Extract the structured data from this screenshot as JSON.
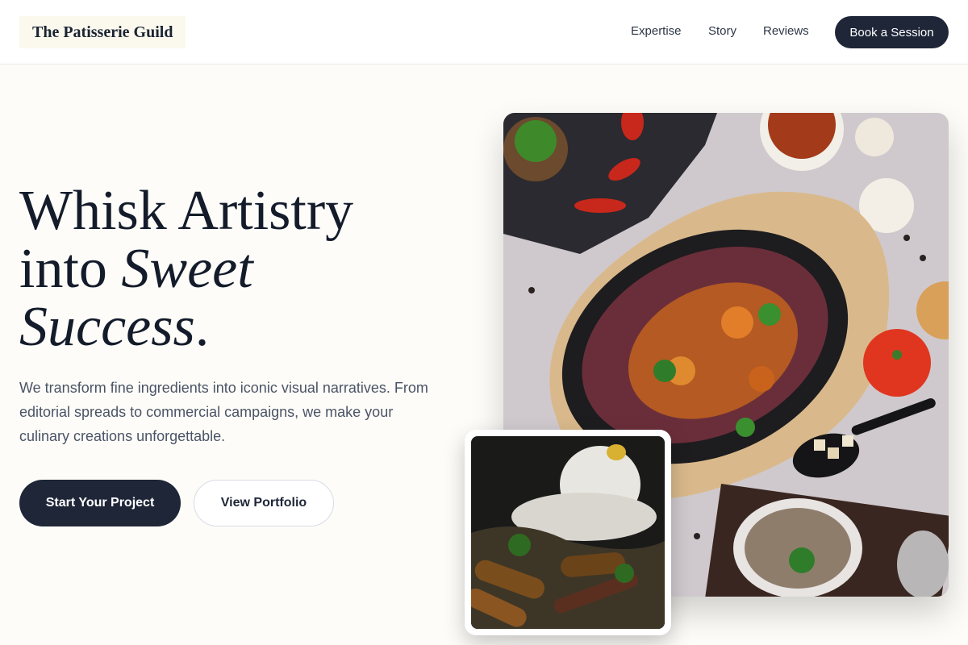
{
  "brand": {
    "name": "The Patisserie Guild"
  },
  "nav": {
    "links": [
      "Expertise",
      "Story",
      "Reviews"
    ],
    "cta_label": "Book a Session"
  },
  "hero": {
    "headline_line1": "Whisk Artistry",
    "headline_line2_plain": "into ",
    "headline_line2_italic": "Sweet",
    "headline_line3_italic": "Success",
    "headline_line3_end": ".",
    "subtext": "We transform fine ingredients into iconic visual narratives. From editorial spreads to commercial campaigns, we make your culinary creations unforgettable.",
    "primary_button": "Start Your Project",
    "secondary_button": "View Portfolio"
  },
  "images": {
    "main_photo": "food-platter-photo",
    "inset_photo": "grilled-corn-photo"
  },
  "colors": {
    "dark": "#1e2638",
    "background": "#fdfcf8"
  }
}
